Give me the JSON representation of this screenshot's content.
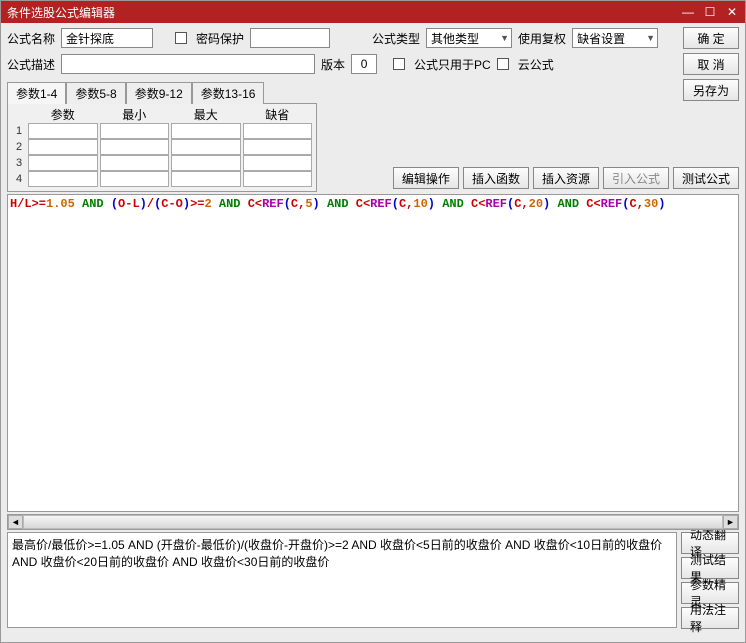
{
  "window": {
    "title": "条件选股公式编辑器"
  },
  "header": {
    "name_label": "公式名称",
    "name_value": "金针探底",
    "pwd_label": "密码保护",
    "pwd_value": "",
    "type_label": "公式类型",
    "type_value": "其他类型",
    "fuquan_label": "使用复权",
    "fuquan_value": "缺省设置",
    "ok_btn": "确  定",
    "desc_label": "公式描述",
    "desc_value": "",
    "version_label": "版本",
    "version_value": "0",
    "pc_only_label": "公式只用于PC",
    "cloud_label": "云公式",
    "cancel_btn": "取  消",
    "saveas_btn": "另存为"
  },
  "tabs": [
    "参数1-4",
    "参数5-8",
    "参数9-12",
    "参数13-16"
  ],
  "param_table": {
    "cols": [
      "参数",
      "最小",
      "最大",
      "缺省"
    ],
    "rows": [
      "1",
      "2",
      "3",
      "4"
    ]
  },
  "action_bar": {
    "edit_op": "编辑操作",
    "insert_fn": "插入函数",
    "insert_res": "插入资源",
    "import_formula": "引入公式",
    "test_formula": "测试公式"
  },
  "code_segments": [
    {
      "t": "H",
      "c": "op"
    },
    {
      "t": "/",
      "c": "op"
    },
    {
      "t": "L",
      "c": "op"
    },
    {
      "t": ">=",
      "c": "op"
    },
    {
      "t": "1.05",
      "c": "num"
    },
    {
      "t": " ",
      "c": ""
    },
    {
      "t": "AND",
      "c": "kw"
    },
    {
      "t": " ",
      "c": ""
    },
    {
      "t": "(",
      "c": "br"
    },
    {
      "t": "O",
      "c": "op"
    },
    {
      "t": "-",
      "c": "op"
    },
    {
      "t": "L",
      "c": "op"
    },
    {
      "t": ")",
      "c": "br"
    },
    {
      "t": "/",
      "c": "op"
    },
    {
      "t": "(",
      "c": "br"
    },
    {
      "t": "C",
      "c": "op"
    },
    {
      "t": "-",
      "c": "op"
    },
    {
      "t": "O",
      "c": "op"
    },
    {
      "t": ")",
      "c": "br"
    },
    {
      "t": ">=",
      "c": "op"
    },
    {
      "t": "2",
      "c": "num"
    },
    {
      "t": " ",
      "c": ""
    },
    {
      "t": "AND",
      "c": "kw"
    },
    {
      "t": " ",
      "c": ""
    },
    {
      "t": "C",
      "c": "op"
    },
    {
      "t": "<",
      "c": "op"
    },
    {
      "t": "REF",
      "c": "fn"
    },
    {
      "t": "(",
      "c": "br"
    },
    {
      "t": "C",
      "c": "op"
    },
    {
      "t": ",",
      "c": "op"
    },
    {
      "t": "5",
      "c": "num"
    },
    {
      "t": ")",
      "c": "br"
    },
    {
      "t": " ",
      "c": ""
    },
    {
      "t": "AND",
      "c": "kw"
    },
    {
      "t": " ",
      "c": ""
    },
    {
      "t": "C",
      "c": "op"
    },
    {
      "t": "<",
      "c": "op"
    },
    {
      "t": "REF",
      "c": "fn"
    },
    {
      "t": "(",
      "c": "br"
    },
    {
      "t": "C",
      "c": "op"
    },
    {
      "t": ",",
      "c": "op"
    },
    {
      "t": "10",
      "c": "num"
    },
    {
      "t": ")",
      "c": "br"
    },
    {
      "t": " ",
      "c": ""
    },
    {
      "t": "AND",
      "c": "kw"
    },
    {
      "t": " ",
      "c": ""
    },
    {
      "t": "C",
      "c": "op"
    },
    {
      "t": "<",
      "c": "op"
    },
    {
      "t": "REF",
      "c": "fn"
    },
    {
      "t": "(",
      "c": "br"
    },
    {
      "t": "C",
      "c": "op"
    },
    {
      "t": ",",
      "c": "op"
    },
    {
      "t": "20",
      "c": "num"
    },
    {
      "t": ")",
      "c": "br"
    },
    {
      "t": " ",
      "c": ""
    },
    {
      "t": "AND",
      "c": "kw"
    },
    {
      "t": " ",
      "c": ""
    },
    {
      "t": "C",
      "c": "op"
    },
    {
      "t": "<",
      "c": "op"
    },
    {
      "t": "REF",
      "c": "fn"
    },
    {
      "t": "(",
      "c": "br"
    },
    {
      "t": "C",
      "c": "op"
    },
    {
      "t": ",",
      "c": "op"
    },
    {
      "t": "30",
      "c": "num"
    },
    {
      "t": ")",
      "c": "br"
    }
  ],
  "translation_text": "最高价/最低价>=1.05 AND (开盘价-最低价)/(收盘价-开盘价)>=2 AND 收盘价<5日前的收盘价 AND 收盘价<10日前的收盘价 AND 收盘价<20日前的收盘价 AND 收盘价<30日前的收盘价",
  "side_buttons": {
    "dyn_trans": "动态翻译",
    "test_result": "测试结果",
    "param_wizard": "参数精灵",
    "usage_note": "用法注释"
  }
}
